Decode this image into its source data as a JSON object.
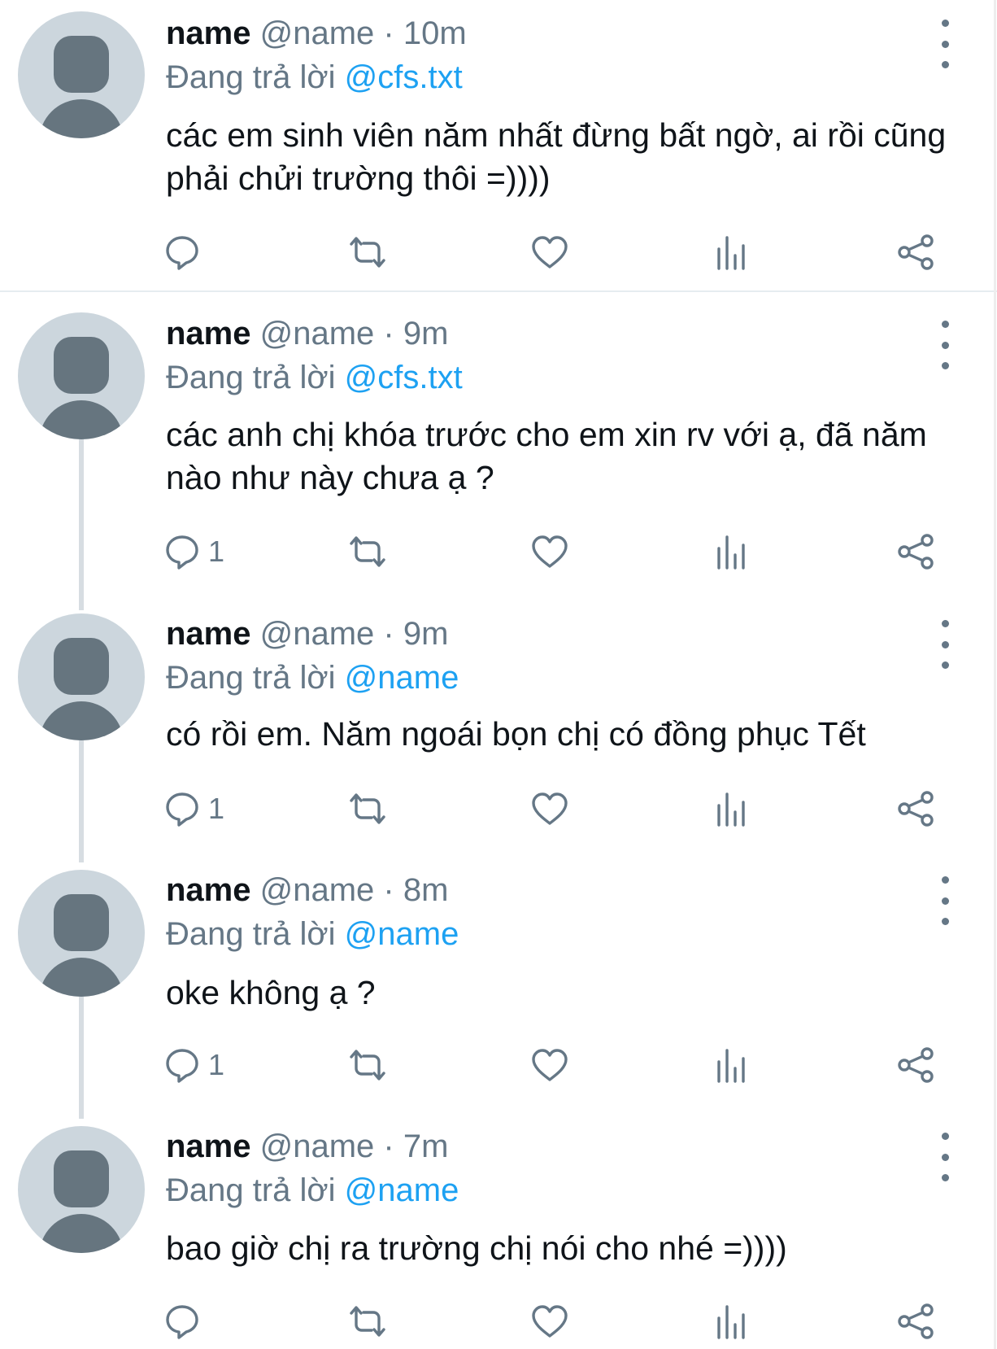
{
  "tweets": [
    {
      "name": "name",
      "handle": "@name",
      "separator": "·",
      "time": "10m",
      "reply_prefix": "Đang trả lời",
      "reply_to": "@cfs.txt",
      "text": "các em sinh viên năm nhất đừng bất ngờ, ai rồi cũng phải chửi trường thôi =))))",
      "reply_count": ""
    },
    {
      "name": "name",
      "handle": "@name",
      "separator": "·",
      "time": "9m",
      "reply_prefix": "Đang trả lời",
      "reply_to": "@cfs.txt",
      "text": "các anh chị khóa trước cho em xin rv với ạ, đã năm nào như này chưa ạ ?",
      "reply_count": "1"
    },
    {
      "name": "name",
      "handle": "@name",
      "separator": "·",
      "time": "9m",
      "reply_prefix": "Đang trả lời",
      "reply_to": "@name",
      "text": "có rồi em. Năm ngoái bọn chị có đồng phục Tết",
      "reply_count": "1"
    },
    {
      "name": "name",
      "handle": "@name",
      "separator": "·",
      "time": "8m",
      "reply_prefix": "Đang trả lời",
      "reply_to": "@name",
      "text": "oke không ạ ?",
      "reply_count": "1"
    },
    {
      "name": "name",
      "handle": "@name",
      "separator": "·",
      "time": "7m",
      "reply_prefix": "Đang trả lời",
      "reply_to": "@name",
      "text": "bao giờ chị ra trường chị nói cho nhé =))))",
      "reply_count": ""
    }
  ],
  "icons": {
    "reply": "reply-icon",
    "retweet": "retweet-icon",
    "like": "heart-icon",
    "stats": "analytics-icon",
    "share": "share-icon",
    "more": "more-vertical-icon"
  },
  "colors": {
    "text": "#0f1419",
    "secondary": "#657786",
    "link": "#1da1f2",
    "avatar_bg": "#ccd6dd",
    "avatar_fg": "#66757f",
    "thread_line": "#d7dde2"
  }
}
